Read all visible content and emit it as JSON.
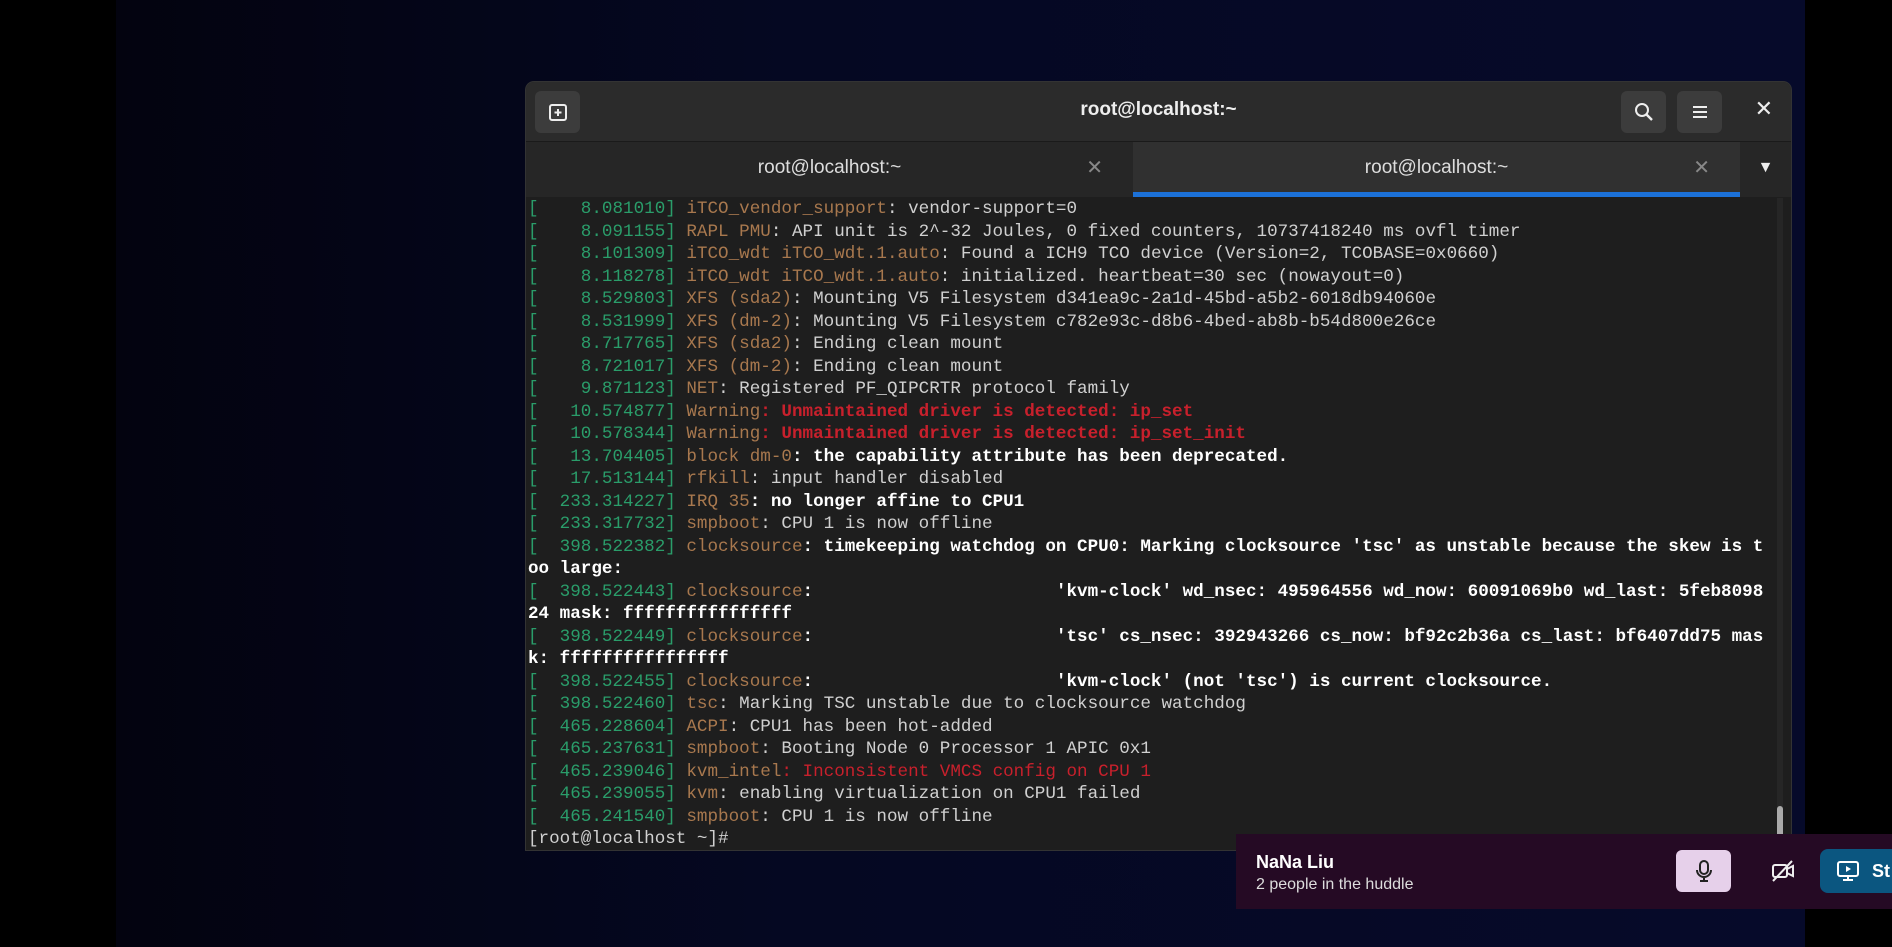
{
  "window": {
    "title": "root@localhost:~"
  },
  "tabs": [
    {
      "label": "root@localhost:~",
      "active": false
    },
    {
      "label": "root@localhost:~",
      "active": true
    }
  ],
  "terminal": {
    "lines": [
      [
        [
          "ts",
          "[    8.081010] "
        ],
        [
          "src",
          "iTCO_vendor_support"
        ],
        [
          "n",
          ": vendor-support=0"
        ]
      ],
      [
        [
          "ts",
          "[    8.091155] "
        ],
        [
          "src",
          "RAPL PMU"
        ],
        [
          "n",
          ": API unit is 2^-32 Joules, 0 fixed counters, 10737418240 ms ovfl timer"
        ]
      ],
      [
        [
          "ts",
          "[    8.101309] "
        ],
        [
          "src",
          "iTCO_wdt iTCO_wdt.1.auto"
        ],
        [
          "n",
          ": Found a ICH9 TCO device (Version=2, TCOBASE=0x0660)"
        ]
      ],
      [
        [
          "ts",
          "[    8.118278] "
        ],
        [
          "src",
          "iTCO_wdt iTCO_wdt.1.auto"
        ],
        [
          "n",
          ": initialized. heartbeat=30 sec (nowayout=0)"
        ]
      ],
      [
        [
          "ts",
          "[    8.529803] "
        ],
        [
          "src",
          "XFS (sda2)"
        ],
        [
          "n",
          ": Mounting V5 Filesystem d341ea9c-2a1d-45bd-a5b2-6018db94060e"
        ]
      ],
      [
        [
          "ts",
          "[    8.531999] "
        ],
        [
          "src",
          "XFS (dm-2)"
        ],
        [
          "n",
          ": Mounting V5 Filesystem c782e93c-d8b6-4bed-ab8b-b54d800e26ce"
        ]
      ],
      [
        [
          "ts",
          "[    8.717765] "
        ],
        [
          "src",
          "XFS (sda2)"
        ],
        [
          "n",
          ": Ending clean mount"
        ]
      ],
      [
        [
          "ts",
          "[    8.721017] "
        ],
        [
          "src",
          "XFS (dm-2)"
        ],
        [
          "n",
          ": Ending clean mount"
        ]
      ],
      [
        [
          "ts",
          "[    9.871123] "
        ],
        [
          "src",
          "NET"
        ],
        [
          "n",
          ": Registered PF_QIPCRTR protocol family"
        ]
      ],
      [
        [
          "ts",
          "[   10.574877] "
        ],
        [
          "src",
          "Warning"
        ],
        [
          "red",
          ": Unmaintained driver is detected: ip_set"
        ]
      ],
      [
        [
          "ts",
          "[   10.578344] "
        ],
        [
          "src",
          "Warning"
        ],
        [
          "red",
          ": Unmaintained driver is detected: ip_set_init"
        ]
      ],
      [
        [
          "ts",
          "[   13.704405] "
        ],
        [
          "src",
          "block dm-0"
        ],
        [
          "b",
          ": the capability attribute has been deprecated."
        ]
      ],
      [
        [
          "ts",
          "[   17.513144] "
        ],
        [
          "src",
          "rfkill"
        ],
        [
          "n",
          ": input handler disabled"
        ]
      ],
      [
        [
          "ts",
          "[  233.314227] "
        ],
        [
          "src",
          "IRQ 35"
        ],
        [
          "b",
          ": no longer affine to CPU1"
        ]
      ],
      [
        [
          "ts",
          "[  233.317732] "
        ],
        [
          "src",
          "smpboot"
        ],
        [
          "n",
          ": CPU 1 is now offline"
        ]
      ],
      [
        [
          "ts",
          "[  398.522382] "
        ],
        [
          "src",
          "clocksource"
        ],
        [
          "b",
          ": timekeeping watchdog on CPU0: Marking clocksource 'tsc' as unstable because the skew is too large:"
        ]
      ],
      [
        [
          "ts",
          "[  398.522443] "
        ],
        [
          "src",
          "clocksource"
        ],
        [
          "b",
          ":                       'kvm-clock' wd_nsec: 495964556 wd_now: 60091069b0 wd_last: 5feb809824 mask: ffffffffffffffff"
        ]
      ],
      [
        [
          "ts",
          "[  398.522449] "
        ],
        [
          "src",
          "clocksource"
        ],
        [
          "b",
          ":                       'tsc' cs_nsec: 392943266 cs_now: bf92c2b36a cs_last: bf6407dd75 mask: ffffffffffffffff"
        ]
      ],
      [
        [
          "ts",
          "[  398.522455] "
        ],
        [
          "src",
          "clocksource"
        ],
        [
          "b",
          ":                       'kvm-clock' (not 'tsc') is current clocksource."
        ]
      ],
      [
        [
          "ts",
          "[  398.522460] "
        ],
        [
          "src",
          "tsc"
        ],
        [
          "n",
          ": Marking TSC unstable due to clocksource watchdog"
        ]
      ],
      [
        [
          "ts",
          "[  465.228604] "
        ],
        [
          "src",
          "ACPI"
        ],
        [
          "n",
          ": CPU1 has been hot-added"
        ]
      ],
      [
        [
          "ts",
          "[  465.237631] "
        ],
        [
          "src",
          "smpboot"
        ],
        [
          "n",
          ": Booting Node 0 Processor 1 APIC 0x1"
        ]
      ],
      [
        [
          "ts",
          "[  465.239046] "
        ],
        [
          "src",
          "kvm_intel"
        ],
        [
          "redn",
          ": Inconsistent VMCS config on CPU 1"
        ]
      ],
      [
        [
          "ts",
          "[  465.239055] "
        ],
        [
          "src",
          "kvm"
        ],
        [
          "n",
          ": enabling virtualization on CPU1 failed"
        ]
      ],
      [
        [
          "ts",
          "[  465.241540] "
        ],
        [
          "src",
          "smpboot"
        ],
        [
          "n",
          ": CPU 1 is now offline"
        ]
      ]
    ],
    "prompt": "[root@localhost ~]#"
  },
  "huddle": {
    "name": "NaNa Liu",
    "subtitle": "2 people in the huddle",
    "share_label": "St"
  }
}
